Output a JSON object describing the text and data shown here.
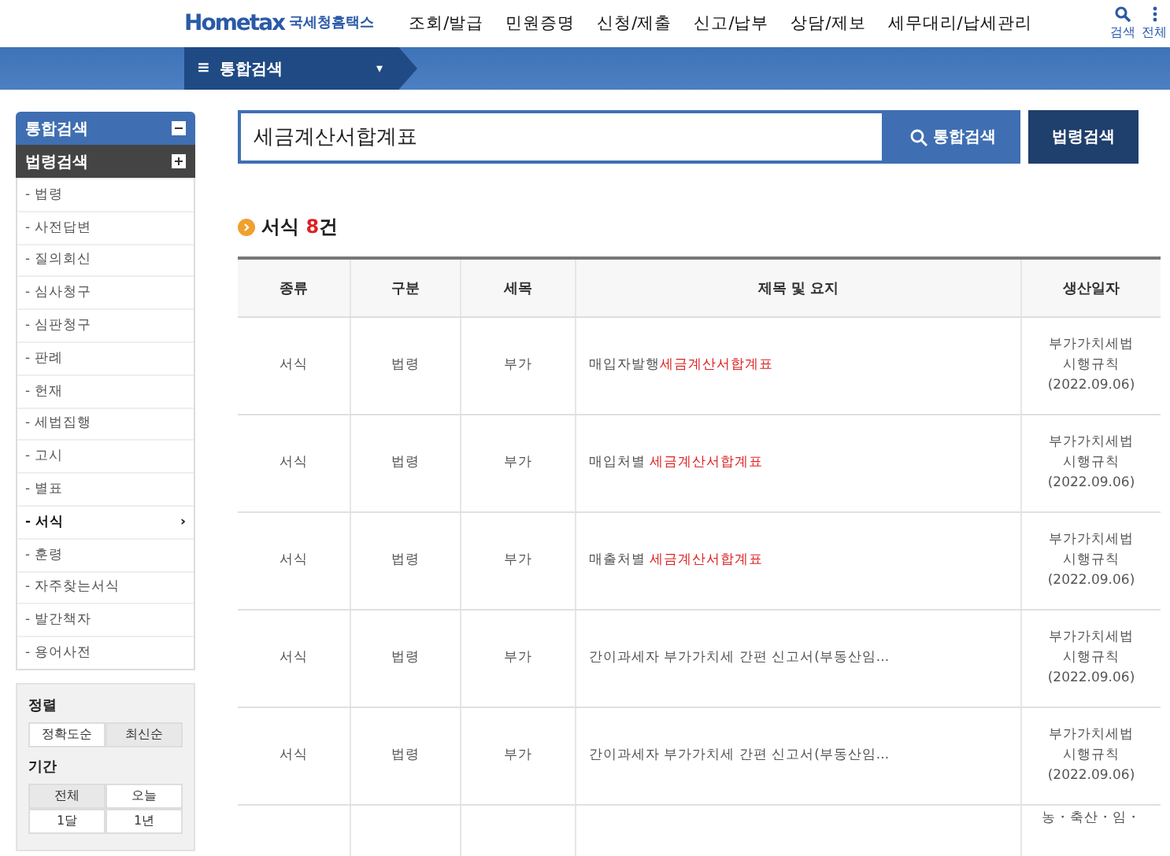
{
  "header": {
    "logo": "Hometax",
    "logo_sub": "국세청홈택스",
    "nav": [
      "조회/발급",
      "민원증명",
      "신청/제출",
      "신고/납부",
      "상담/제보",
      "세무대리/납세관리"
    ],
    "tools": [
      {
        "kind": "search",
        "label": "검색"
      },
      {
        "kind": "all",
        "label": "전체"
      }
    ]
  },
  "breadcrumb": {
    "menu_icon": "≡",
    "label": "통합검색",
    "caret": "▾"
  },
  "sidebar": {
    "headers": [
      {
        "label": "통합검색",
        "selected": false,
        "kind": "minus"
      },
      {
        "label": "법령검색",
        "selected": true,
        "kind": "plus"
      }
    ],
    "items": [
      {
        "label": "- 법령",
        "selected": false
      },
      {
        "label": "- 사전답변",
        "selected": false
      },
      {
        "label": "- 질의회신",
        "selected": false
      },
      {
        "label": "- 심사청구",
        "selected": false
      },
      {
        "label": "- 심판청구",
        "selected": false
      },
      {
        "label": "- 판례",
        "selected": false
      },
      {
        "label": "- 헌재",
        "selected": false
      },
      {
        "label": "- 세법집행",
        "selected": false
      },
      {
        "label": "- 고시",
        "selected": false
      },
      {
        "label": "- 별표",
        "selected": false
      },
      {
        "label": "- 서식",
        "selected": true,
        "chevron": "›"
      },
      {
        "label": "- 훈령",
        "selected": false
      },
      {
        "label": "- 자주찾는서식",
        "selected": false
      },
      {
        "label": "- 발간책자",
        "selected": false
      },
      {
        "label": "- 용어사전",
        "selected": false
      }
    ],
    "sort": {
      "title": "정렬",
      "options": [
        {
          "label": "정확도순",
          "selected": false
        },
        {
          "label": "최신순",
          "selected": true
        }
      ]
    },
    "period": {
      "title": "기간",
      "options": [
        {
          "label": "전체",
          "selected": true
        },
        {
          "label": "오늘",
          "selected": false
        },
        {
          "label": "1달",
          "selected": false
        },
        {
          "label": "1년",
          "selected": false
        }
      ]
    }
  },
  "search": {
    "value": "세금계산서합계표",
    "button": "통합검색",
    "law_button": "법령검색"
  },
  "result": {
    "label": "서식",
    "count": "8",
    "unit": "건"
  },
  "table": {
    "columns": [
      "종류",
      "구분",
      "세목",
      "제목 및 요지",
      "생산일자"
    ],
    "rows": [
      {
        "type": "서식",
        "category": "법령",
        "tax": "부가",
        "title": "매입자발행",
        "highlight": "세금계산서합계표",
        "source": [
          "부가가치세법",
          "시행규칙",
          "(2022.09.06)"
        ]
      },
      {
        "type": "서식",
        "category": "법령",
        "tax": "부가",
        "title": "매입처별 ",
        "highlight": "세금계산서합계표",
        "source": [
          "부가가치세법",
          "시행규칙",
          "(2022.09.06)"
        ]
      },
      {
        "type": "서식",
        "category": "법령",
        "tax": "부가",
        "title": "매출처별 ",
        "highlight": "세금계산서합계표",
        "source": [
          "부가가치세법",
          "시행규칙",
          "(2022.09.06)"
        ]
      },
      {
        "type": "서식",
        "category": "법령",
        "tax": "부가",
        "title": "간이과세자 부가가치세 간편 신고서(부동산임...",
        "source": [
          "부가가치세법",
          "시행규칙",
          "(2022.09.06)"
        ]
      },
      {
        "type": "서식",
        "category": "법령",
        "tax": "부가",
        "title": "간이과세자 부가가치세 간편 신고서(부동산임...",
        "source": [
          "부가가치세법",
          "시행규칙",
          "(2022.09.06)"
        ]
      },
      {
        "source": [
          "농・축산・임・"
        ]
      }
    ]
  }
}
